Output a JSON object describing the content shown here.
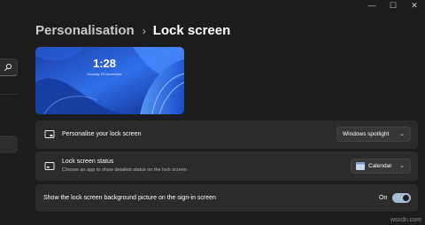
{
  "window": {
    "minimize_label": "—",
    "maximize_label": "☐",
    "close_label": "✕"
  },
  "header": {
    "parent": "Personalisation",
    "separator": "›",
    "current": "Lock screen"
  },
  "preview": {
    "time": "1:28",
    "date": "Monday 29 November"
  },
  "settings": {
    "personalise": {
      "label": "Personalise your lock screen",
      "value": "Windows spotlight"
    },
    "status": {
      "label": "Lock screen status",
      "description": "Choose an app to show detailed status on the lock screen",
      "value": "Calendar"
    },
    "signin_background": {
      "label": "Show the lock screen background picture on the sign-in screen",
      "state_label": "On",
      "state": true
    }
  },
  "watermark": "wsxdn.com",
  "colors": {
    "background": "#1c1c1c",
    "card": "#2b2b2b",
    "toggle_on": "#a8bcd6",
    "accent_blue": "#2f6fe8"
  },
  "icons": {
    "search": "search-icon",
    "personalise": "lock-screen-image-icon",
    "status": "lock-screen-status-icon",
    "calendar": "calendar-icon",
    "dropdown": "chevron-down-icon"
  }
}
